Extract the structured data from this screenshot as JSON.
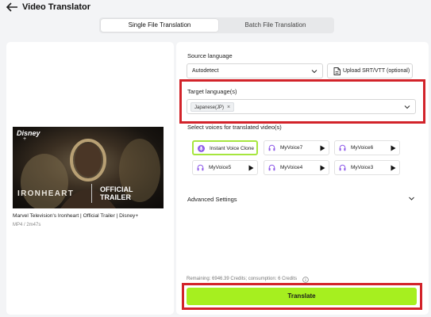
{
  "header": {
    "title": "Video Translator"
  },
  "tabs": [
    {
      "label": "Single File Translation",
      "active": true
    },
    {
      "label": "Batch File Translation",
      "active": false
    }
  ],
  "video": {
    "name": "Marvel Television's Ironheart | Official Trailer | Disney+",
    "meta": "MP4 / 2m47s",
    "thumbnail": {
      "brand": "Disney",
      "brand_plus": "+",
      "title": "IRONHEART",
      "trailer_line1": "OFFICIAL",
      "trailer_line2": "TRAILER"
    }
  },
  "source": {
    "label": "Source language",
    "value": "Autodetect",
    "upload_label": "Upload SRT/VTT (optional)"
  },
  "target": {
    "label": "Target language(s)",
    "chip": "Japanese(JP)",
    "chip_close": "×"
  },
  "voices": {
    "label": "Select voices for translated video(s)",
    "items": [
      {
        "name": "Instant Voice Clone",
        "selected": true
      },
      {
        "name": "MyVoice7"
      },
      {
        "name": "MyVoice6"
      },
      {
        "name": "MyVoice5"
      },
      {
        "name": "MyVoice4"
      },
      {
        "name": "MyVoice3"
      }
    ]
  },
  "advanced": {
    "label": "Advanced Settings"
  },
  "footer": {
    "remaining": "Remaining: 6946.39 Credits; consumption: 6 Credits",
    "translate_label": "Translate"
  },
  "colors": {
    "accent": "#a6ef1f",
    "highlight": "#d2232a",
    "selected_border": "#a6e63e",
    "voice_icon": "#8f5be8"
  }
}
